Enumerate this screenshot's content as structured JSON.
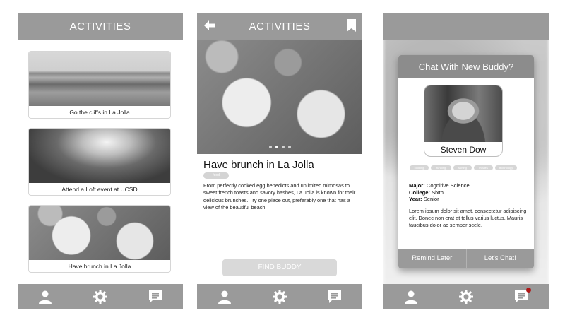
{
  "screen1": {
    "title": "ACTIVITIES",
    "cards": [
      {
        "caption": "Go the cliffs in La Jolla"
      },
      {
        "caption": "Attend a Loft event at UCSD"
      },
      {
        "caption": "Have brunch in La Jolla"
      }
    ],
    "nav": [
      "profile-icon",
      "gear-icon",
      "chat-icon"
    ]
  },
  "screen2": {
    "title": "ACTIVITIES",
    "activity_title": "Have brunch in La Jolla",
    "tag": "food",
    "description": "From perfectly cooked egg benedicts and unlimited mimosas to sweet french toasts and savory hashes, La Jolla is known for their delicious brunches. Try one place out, preferably one that has a view of the beautiful beach!",
    "find_button": "FIND BUDDY",
    "carousel_slides": 4,
    "carousel_active": 2
  },
  "screen3": {
    "modal_title": "Chat With New Buddy?",
    "buddy_name": "Steven Dow",
    "interests": [
      "cooking",
      "running",
      "surfing",
      "movies",
      "technology"
    ],
    "major_label": "Major:",
    "major": "Cognitive Science",
    "college_label": "College:",
    "college": "Sixth",
    "year_label": "Year:",
    "year": "Senior",
    "bio": "Lorem ipsum dolor sit amet, consectetur adipiscing elit. Donec non erat at tellus varius luctus. Mauris faucibus dolor ac semper scele.",
    "remind_button": "Remind Later",
    "chat_button": "Let's Chat!"
  },
  "colors": {
    "bar_gray": "#9a9a9a",
    "modal_head": "#8c8c8c",
    "notification_dot": "#b01818",
    "button_disabled": "#d9d9d9"
  }
}
